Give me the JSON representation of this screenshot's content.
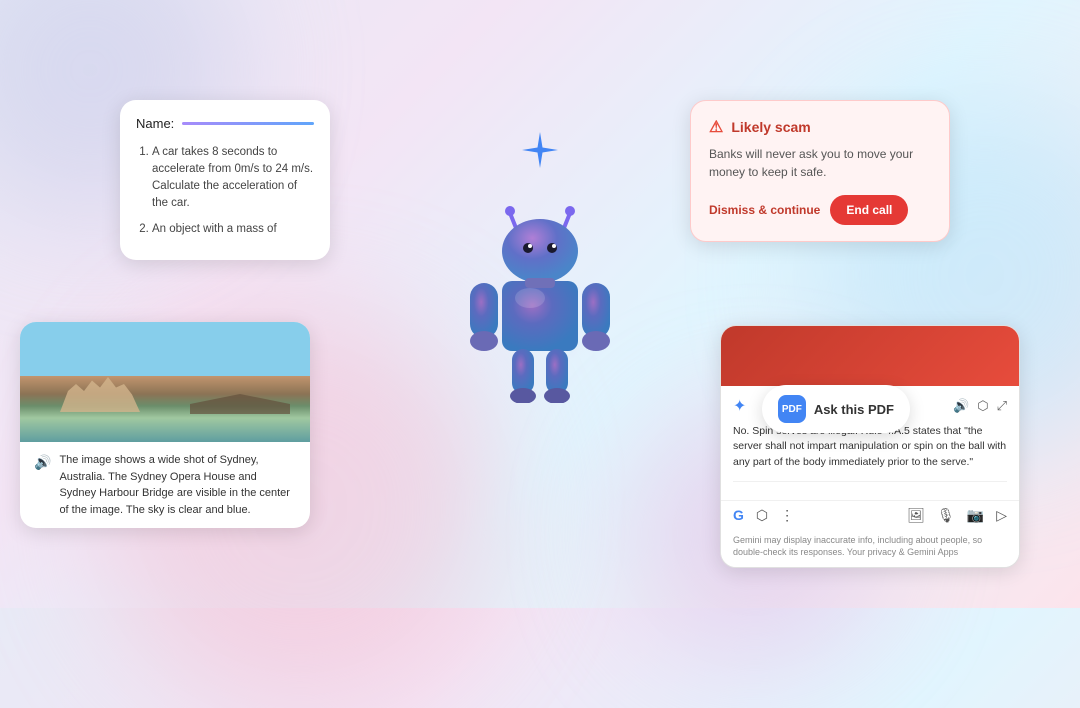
{
  "background": {
    "colors": [
      "#e8eaf6",
      "#f3e5f5",
      "#e1f5fe",
      "#fce4ec"
    ]
  },
  "homework_card": {
    "name_label": "Name:",
    "items": [
      "A car takes 8 seconds to accelerate from 0m/s to 24 m/s. Calculate the acceleration of the car.",
      "An object with a mass of"
    ]
  },
  "scam_card": {
    "title": "Likely scam",
    "body": "Banks will never ask you to move your money to keep it safe.",
    "dismiss_label": "Dismiss & continue",
    "end_call_label": "End call"
  },
  "sydney_card": {
    "caption": "The image shows a wide shot of Sydney, Australia. The Sydney Opera House and Sydney Harbour Bridge are visible in the center of the image. The sky is clear and blue."
  },
  "gemini_panel": {
    "body": "No. Spin serves are illegal. Rule 4.A.5 states that \"the server shall not impart manipulation or spin on the ball with any part of the body immediately prior to the serve.\"",
    "disclaimer": "Gemini may display inaccurate info, including about people, so double-check its responses. Your privacy & Gemini Apps"
  },
  "ask_pdf_badge": {
    "label": "Ask this PDF",
    "icon_label": "PDF"
  },
  "sparkle": "✦"
}
